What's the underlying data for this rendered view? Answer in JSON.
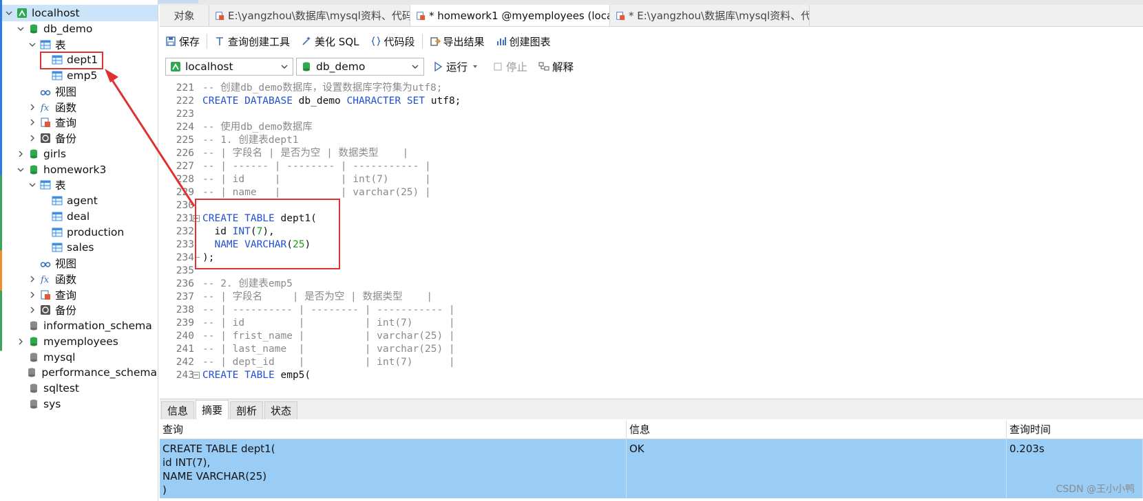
{
  "tree": [
    {
      "label": "localhost",
      "level": 0,
      "expanded": true,
      "icon": "connection-icon",
      "selected": true
    },
    {
      "label": "db_demo",
      "level": 1,
      "expanded": true,
      "icon": "database-green-icon"
    },
    {
      "label": "表",
      "level": 2,
      "expanded": true,
      "icon": "table-folder-icon"
    },
    {
      "label": "dept1",
      "level": 3,
      "icon": "table-icon"
    },
    {
      "label": "emp5",
      "level": 3,
      "icon": "table-icon"
    },
    {
      "label": "视图",
      "level": 2,
      "icon": "view-icon"
    },
    {
      "label": "函数",
      "level": 2,
      "collapsed": true,
      "icon": "function-icon"
    },
    {
      "label": "查询",
      "level": 2,
      "collapsed": true,
      "icon": "query-icon"
    },
    {
      "label": "备份",
      "level": 2,
      "collapsed": true,
      "icon": "backup-icon"
    },
    {
      "label": "girls",
      "level": 1,
      "collapsed": true,
      "icon": "database-green-icon"
    },
    {
      "label": "homework3",
      "level": 1,
      "expanded": true,
      "icon": "database-green-icon"
    },
    {
      "label": "表",
      "level": 2,
      "expanded": true,
      "icon": "table-folder-icon"
    },
    {
      "label": "agent",
      "level": 3,
      "icon": "table-icon"
    },
    {
      "label": "deal",
      "level": 3,
      "icon": "table-icon"
    },
    {
      "label": "production",
      "level": 3,
      "icon": "table-icon"
    },
    {
      "label": "sales",
      "level": 3,
      "icon": "table-icon"
    },
    {
      "label": "视图",
      "level": 2,
      "icon": "view-icon"
    },
    {
      "label": "函数",
      "level": 2,
      "collapsed": true,
      "icon": "function-icon"
    },
    {
      "label": "查询",
      "level": 2,
      "collapsed": true,
      "icon": "query-icon"
    },
    {
      "label": "备份",
      "level": 2,
      "collapsed": true,
      "icon": "backup-icon"
    },
    {
      "label": "information_schema",
      "level": 1,
      "icon": "database-gray-icon"
    },
    {
      "label": "myemployees",
      "level": 1,
      "collapsed": true,
      "icon": "database-green-icon"
    },
    {
      "label": "mysql",
      "level": 1,
      "icon": "database-gray-icon"
    },
    {
      "label": "performance_schema",
      "level": 1,
      "icon": "database-gray-icon"
    },
    {
      "label": "sqltest",
      "level": 1,
      "icon": "database-gray-icon"
    },
    {
      "label": "sys",
      "level": 1,
      "icon": "database-gray-icon"
    }
  ],
  "tabs": [
    {
      "label": "对象",
      "icon": "",
      "active": false
    },
    {
      "label": "E:\\yangzhou\\数据库\\mysql资料、代码...",
      "icon": "query-tab-icon",
      "active": false
    },
    {
      "label": "* homework1 @myemployees (local...",
      "icon": "query-tab-icon",
      "active": true
    },
    {
      "label": "* E:\\yangzhou\\数据库\\mysql资料、代...",
      "icon": "query-tab-icon",
      "active": false
    }
  ],
  "toolbar": {
    "save": "保存",
    "query_builder": "查询创建工具",
    "beautify": "美化 SQL",
    "snippet": "代码段",
    "export": "导出结果",
    "chart": "创建图表"
  },
  "selectors": {
    "connection": "localhost",
    "database": "db_demo",
    "run": "运行",
    "stop": "停止",
    "explain": "解释"
  },
  "editor": {
    "lines": [
      {
        "n": "221",
        "t": [
          [
            "cm",
            "-- 创建db_demo数据库，设置数据库字符集为utf8;"
          ]
        ]
      },
      {
        "n": "222",
        "t": [
          [
            "kw",
            "CREATE DATABASE"
          ],
          [
            "tx",
            " db_demo "
          ],
          [
            "kw",
            "CHARACTER SET"
          ],
          [
            "tx",
            " utf8;"
          ]
        ]
      },
      {
        "n": "223",
        "t": []
      },
      {
        "n": "224",
        "t": [
          [
            "cm",
            "-- 使用db_demo数据库"
          ]
        ]
      },
      {
        "n": "225",
        "t": [
          [
            "cm",
            "-- 1. 创建表dept1"
          ]
        ]
      },
      {
        "n": "226",
        "t": [
          [
            "cm",
            "-- | 字段名 | 是否为空 | 数据类型    |"
          ]
        ]
      },
      {
        "n": "227",
        "t": [
          [
            "cm",
            "-- | ------ | -------- | ----------- |"
          ]
        ]
      },
      {
        "n": "228",
        "t": [
          [
            "cm",
            "-- | id     |          | int(7)      |"
          ]
        ]
      },
      {
        "n": "229",
        "t": [
          [
            "cm",
            "-- | name   |          | varchar(25) |"
          ]
        ]
      },
      {
        "n": "230",
        "t": []
      },
      {
        "n": "231",
        "fold": "open",
        "t": [
          [
            "kw",
            "CREATE TABLE"
          ],
          [
            "tx",
            " dept1("
          ]
        ]
      },
      {
        "n": "232",
        "t": [
          [
            "tx",
            "  id "
          ],
          [
            "kw",
            "INT"
          ],
          [
            "tx",
            "("
          ],
          [
            "nm",
            "7"
          ],
          [
            "tx",
            "),"
          ]
        ]
      },
      {
        "n": "233",
        "t": [
          [
            "tx",
            "  "
          ],
          [
            "kw",
            "NAME VARCHAR"
          ],
          [
            "tx",
            "("
          ],
          [
            "nm",
            "25"
          ],
          [
            "tx",
            ")"
          ]
        ]
      },
      {
        "n": "234",
        "fold": "end",
        "t": [
          [
            "tx",
            ");"
          ]
        ]
      },
      {
        "n": "235",
        "t": []
      },
      {
        "n": "236",
        "t": [
          [
            "cm",
            "-- 2. 创建表emp5"
          ]
        ]
      },
      {
        "n": "237",
        "t": [
          [
            "cm",
            "-- | 字段名     | 是否为空 | 数据类型    |"
          ]
        ]
      },
      {
        "n": "238",
        "t": [
          [
            "cm",
            "-- | ---------- | -------- | ----------- |"
          ]
        ]
      },
      {
        "n": "239",
        "t": [
          [
            "cm",
            "-- | id         |          | int(7)      |"
          ]
        ]
      },
      {
        "n": "240",
        "t": [
          [
            "cm",
            "-- | frist_name |          | varchar(25) |"
          ]
        ]
      },
      {
        "n": "241",
        "t": [
          [
            "cm",
            "-- | last_name  |          | varchar(25) |"
          ]
        ]
      },
      {
        "n": "242",
        "t": [
          [
            "cm",
            "-- | dept_id    |          | int(7)      |"
          ]
        ]
      },
      {
        "n": "243",
        "fold": "open",
        "t": [
          [
            "kw",
            "CREATE TABLE"
          ],
          [
            "tx",
            " emp5("
          ]
        ]
      }
    ]
  },
  "result_tabs": [
    {
      "label": "信息",
      "active": false
    },
    {
      "label": "摘要",
      "active": true
    },
    {
      "label": "剖析",
      "active": false
    },
    {
      "label": "状态",
      "active": false
    }
  ],
  "grid": {
    "headers": [
      "查询",
      "信息",
      "查询时间"
    ],
    "row": [
      "CREATE TABLE dept1(\nid INT(7),\nNAME VARCHAR(25)\n)",
      "OK",
      "0.203s"
    ]
  },
  "watermark": "CSDN @王小小鸭",
  "colors": {
    "accent": "#1f4fd6",
    "annotation": "#e03030",
    "selection": "#99cdf6"
  }
}
